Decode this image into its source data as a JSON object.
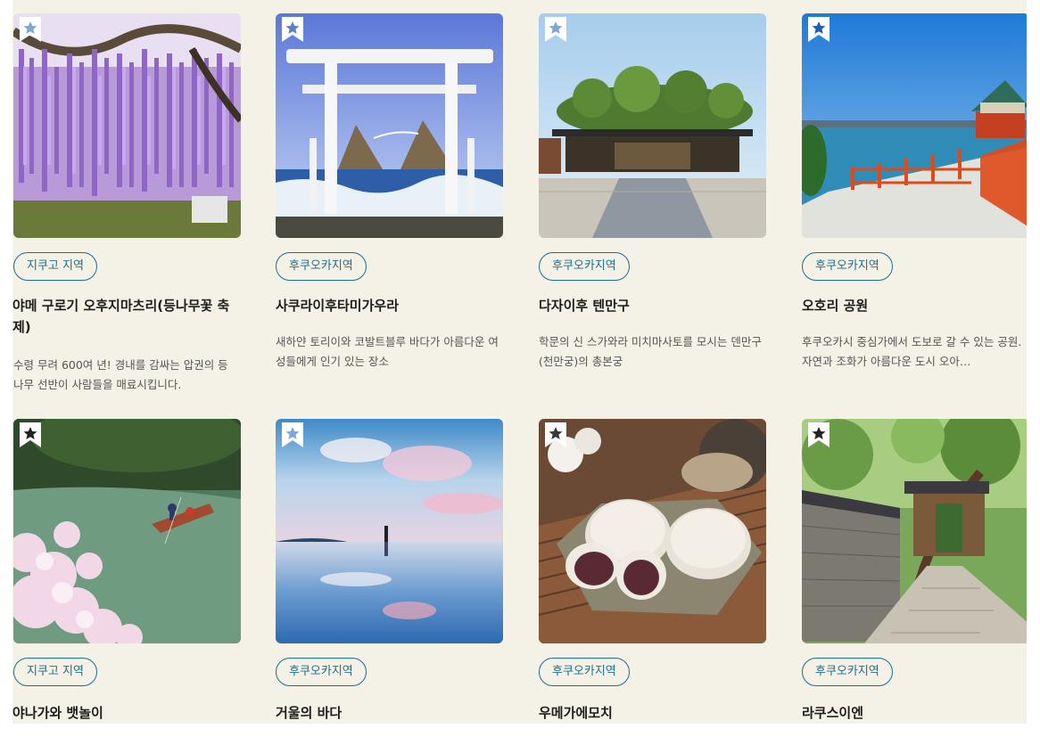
{
  "cards": [
    {
      "tag": "지쿠고 지역",
      "title": "야메 구로기 오후지마츠리(등나무꽃 축제)",
      "desc": "수령 무려 600여 년! 경내를 감싸는 압권의 등나무 선반이 사람들을 매료시킵니다."
    },
    {
      "tag": "후쿠오카지역",
      "title": "사쿠라이후타미가우라",
      "desc": "새하얀 토리이와 코발트블루 바다가 아름다운 여성들에게 인기 있는 장소"
    },
    {
      "tag": "후쿠오카지역",
      "title": "다자이후 텐만구",
      "desc": "학문의 신 스가와라 미치마사토를 모시는 덴만구(천만궁)의 총본궁"
    },
    {
      "tag": "후쿠오카지역",
      "title": "오호리 공원",
      "desc": "후쿠오카시 중심가에서 도보로 갈 수 있는 공원. 자연과 조화가 아름다운 도시 오아…"
    },
    {
      "tag": "지쿠고 지역",
      "title": "야나가와 뱃놀이",
      "desc": ""
    },
    {
      "tag": "후쿠오카지역",
      "title": "거울의 바다",
      "desc": ""
    },
    {
      "tag": "후쿠오카지역",
      "title": "우메가에모치",
      "desc": ""
    },
    {
      "tag": "후쿠오카지역",
      "title": "라쿠스이엔",
      "desc": ""
    }
  ],
  "colors": {
    "accent": "#1a6f8f",
    "background": "#f4f1e6",
    "bookmark_light": "#7fa7d6",
    "bookmark_dark": "#222222"
  },
  "icons": {
    "bookmark": "star-bookmark-icon"
  }
}
